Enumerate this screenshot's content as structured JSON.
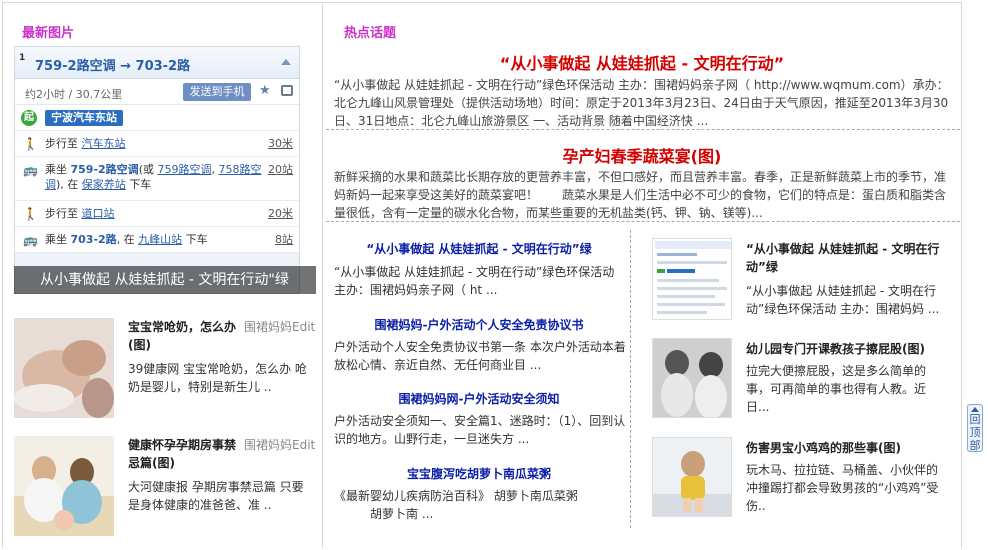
{
  "sections": {
    "latest_title": "最新图片",
    "hot_title": "热点话题"
  },
  "slider": {
    "num": "1",
    "route": "759-2路空调 → 703-2路",
    "time": "约2小时 / 30.7公里",
    "send_btn": "发送到手机",
    "start_badge": "起",
    "start_stop": "宁波汽车东站",
    "steps": [
      {
        "pre": "步行至 ",
        "link": "汽车东站",
        "post": "",
        "dist": "30米"
      },
      {
        "pre": "乘坐 ",
        "bus": "759-2路空调",
        "mid": "(或 ",
        "alt1": "759路空调",
        "sep": ", ",
        "alt2": "758路空调",
        "mid2": "), 在 ",
        "stop": "保家养站",
        "post": " 下车",
        "dist": "20站"
      },
      {
        "pre": "步行至 ",
        "link": "道口站",
        "post": "",
        "dist": "20米"
      },
      {
        "pre": "乘坐 ",
        "bus": "703-2路",
        "mid": ", 在 ",
        "stop": "九峰山站",
        "post": " 下车",
        "dist": "8站"
      }
    ],
    "caption": "从小事做起 从娃娃抓起 - 文明在行动\"绿"
  },
  "left_list": [
    {
      "title": "宝宝常呛奶，怎么办(图)",
      "author": "围裙妈妈Edit",
      "desc": "39健康网 宝宝常呛奶，怎么办 呛奶是婴儿，特别是新生儿 .."
    },
    {
      "title": "健康怀孕孕期房事禁忌篇(图)",
      "author": "围裙妈妈Edit",
      "desc": "大河健康报 孕期房事禁忌篇 只要是身体健康的准爸爸、准 .."
    }
  ],
  "top_news": [
    {
      "headline": "“从小事做起 从娃娃抓起 - 文明在行动”",
      "body": "“从小事做起 从娃娃抓起 - 文明在行动”绿色环保活动 主办：围裙妈妈亲子网（ http://www.wqmum.com）承办：北仑九峰山风景管理处（提供活动场地）时间：原定于2013年3月23日、24日由于天气原因，推延至2013年3月30日、31日地点：北仑九峰山旅游景区 一、活动背景 随着中国经济快 ..."
    },
    {
      "headline": "孕产妇春季蔬菜宴(图)",
      "body": "新鲜采摘的水果和蔬菜比长期存放的更营养丰富，不但口感好，而且营养丰富。春季，正是新鲜蔬菜上市的季节，准妈新妈一起来享受这美好的蔬菜宴吧！　　蔬菜水果是人们生活中必不可少的食物，它们的特点是：蛋白质和脂类含量很低，含有一定量的碳水化合物，而某些重要的无机盐类(钙、钾、钠、镁等)..."
    }
  ],
  "mid_list": [
    {
      "title": "“从小事做起 从娃娃抓起 - 文明在行动”绿",
      "desc": "“从小事做起 从娃娃抓起 - 文明在行动”绿色环保活动 主办：围裙妈妈亲子网（ ht ..."
    },
    {
      "title": "围裙妈妈-户外活动个人安全免责协议书",
      "desc": "户外活动个人安全免责协议书第一条 本次户外活动本着放松心情、亲近自然、无任何商业目 ..."
    },
    {
      "title": "围裙妈妈网-户外活动安全须知",
      "desc": "户外活动安全须知一、安全篇1、迷路时：（1）、回到认识的地方。山野行走，一旦迷失方 ..."
    },
    {
      "title": "宝宝腹泻吃胡萝卜南瓜菜粥",
      "desc": "《最新婴幼儿疾病防治百科》 胡萝卜南瓜菜粥 　　　胡萝卜南 ..."
    }
  ],
  "right_list": [
    {
      "title": "“从小事做起 从娃娃抓起 - 文明在行动”绿",
      "desc": "“从小事做起 从娃娃抓起 - 文明在行动”绿色环保活动 主办：围裙妈妈 ..."
    },
    {
      "title": "幼儿园专门开课教孩子擦屁股(图)",
      "desc": "拉完大便擦屁股，这是多么简单的事，可再简单的事也得有人教。近日..."
    },
    {
      "title": "伤害男宝小鸡鸡的那些事(图)",
      "desc": "玩木马、拉拉链、马桶盖、小伙伴的冲撞踢打都会导致男孩的“小鸡鸡”受伤.."
    }
  ],
  "totop": "回顶部"
}
